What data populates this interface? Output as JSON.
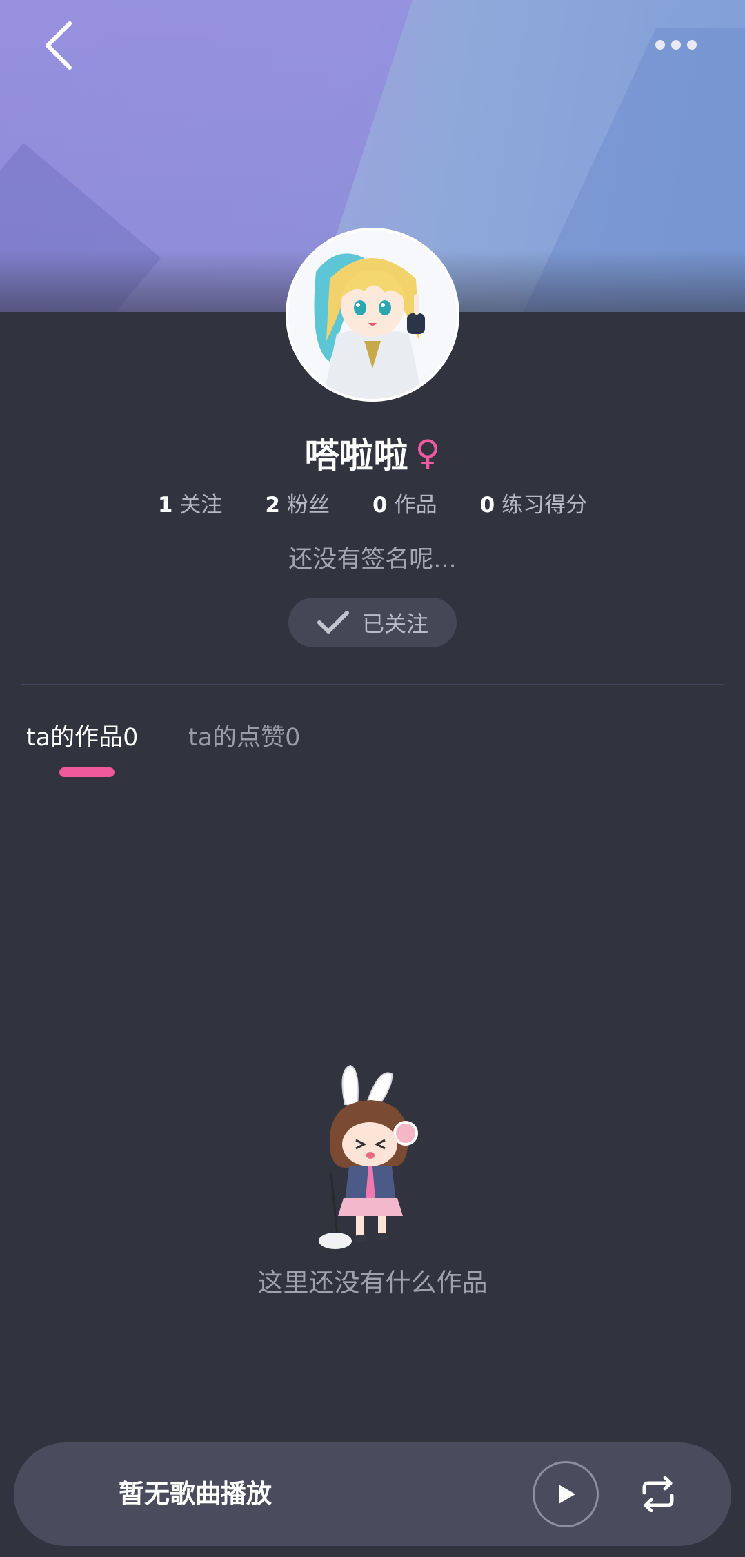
{
  "header": {
    "back_icon": "chevron-left-icon",
    "more_icon": "more-dots-icon"
  },
  "profile": {
    "name": "嗒啦啦",
    "gender_symbol": "♀",
    "gender_color": "#f05aa0",
    "stats": [
      {
        "value": "1",
        "label": "关注"
      },
      {
        "value": "2",
        "label": "粉丝"
      },
      {
        "value": "0",
        "label": "作品"
      },
      {
        "value": "0",
        "label": "练习得分"
      }
    ],
    "signature": "还没有签名呢...",
    "follow_label": "已关注"
  },
  "tabs": [
    {
      "label": "ta的作品0",
      "active": true
    },
    {
      "label": "ta的点赞0",
      "active": false
    }
  ],
  "empty_state": {
    "message": "这里还没有什么作品"
  },
  "player": {
    "label": "暂无歌曲播放",
    "play_icon": "play-icon",
    "loop_icon": "repeat-icon"
  },
  "colors": {
    "accent": "#f05a9b",
    "background": "#31333f",
    "player_bg": "#4a4c5e"
  }
}
